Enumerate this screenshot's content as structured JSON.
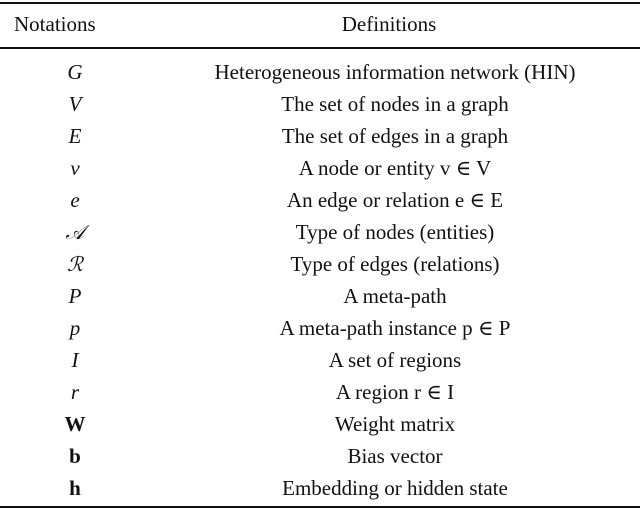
{
  "table": {
    "headers": [
      "Notations",
      "Definitions"
    ],
    "rows": [
      {
        "notation": "G",
        "style": "italic",
        "definition": "Heterogeneous information network (HIN)"
      },
      {
        "notation": "V",
        "style": "italic",
        "definition": "The set of nodes in a graph"
      },
      {
        "notation": "E",
        "style": "italic",
        "definition": "The set of edges in a graph"
      },
      {
        "notation": "v",
        "style": "italic",
        "definition": "A node or entity v ∈ V"
      },
      {
        "notation": "e",
        "style": "italic",
        "definition": "An edge or relation e ∈ E"
      },
      {
        "notation": "𝒜",
        "style": "cal",
        "definition": "Type of nodes (entities)"
      },
      {
        "notation": "ℛ",
        "style": "cal",
        "definition": "Type of edges (relations)"
      },
      {
        "notation": "P",
        "style": "italic",
        "definition": "A meta-path"
      },
      {
        "notation": "p",
        "style": "italic",
        "definition": "A meta-path instance p ∈ P"
      },
      {
        "notation": "I",
        "style": "italic",
        "definition": "A set of regions"
      },
      {
        "notation": "r",
        "style": "italic",
        "definition": "A region r ∈ I"
      },
      {
        "notation": "W",
        "style": "bold",
        "definition": "Weight matrix"
      },
      {
        "notation": "b",
        "style": "bold",
        "definition": "Bias vector"
      },
      {
        "notation": "h",
        "style": "bold",
        "definition": "Embedding or hidden state"
      }
    ]
  }
}
